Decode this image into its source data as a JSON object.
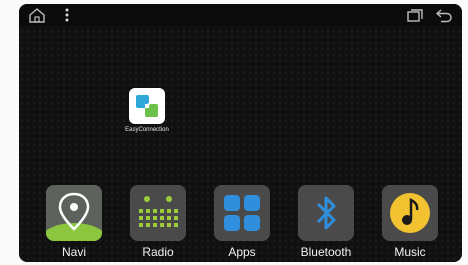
{
  "statusbar": {
    "left_icons": [
      "home-icon",
      "overflow-menu-icon"
    ],
    "right_icons": [
      "recents-icon",
      "back-icon"
    ]
  },
  "desktop": {
    "shortcut": {
      "label": "EasyConnection",
      "icon": "easyconnection-icon"
    }
  },
  "dock": {
    "items": [
      {
        "label": "Navi",
        "icon": "map-pin-icon"
      },
      {
        "label": "Radio",
        "icon": "radio-icon"
      },
      {
        "label": "Apps",
        "icon": "apps-grid-icon"
      },
      {
        "label": "Bluetooth",
        "icon": "bluetooth-icon"
      },
      {
        "label": "Music",
        "icon": "music-note-icon"
      }
    ]
  },
  "colors": {
    "navi_green": "#8cc63f",
    "radio_green": "#9ccc3a",
    "apps_blue": "#2f8fdd",
    "bluetooth_blue": "#2f8fdd",
    "music_yellow": "#f2c230"
  }
}
